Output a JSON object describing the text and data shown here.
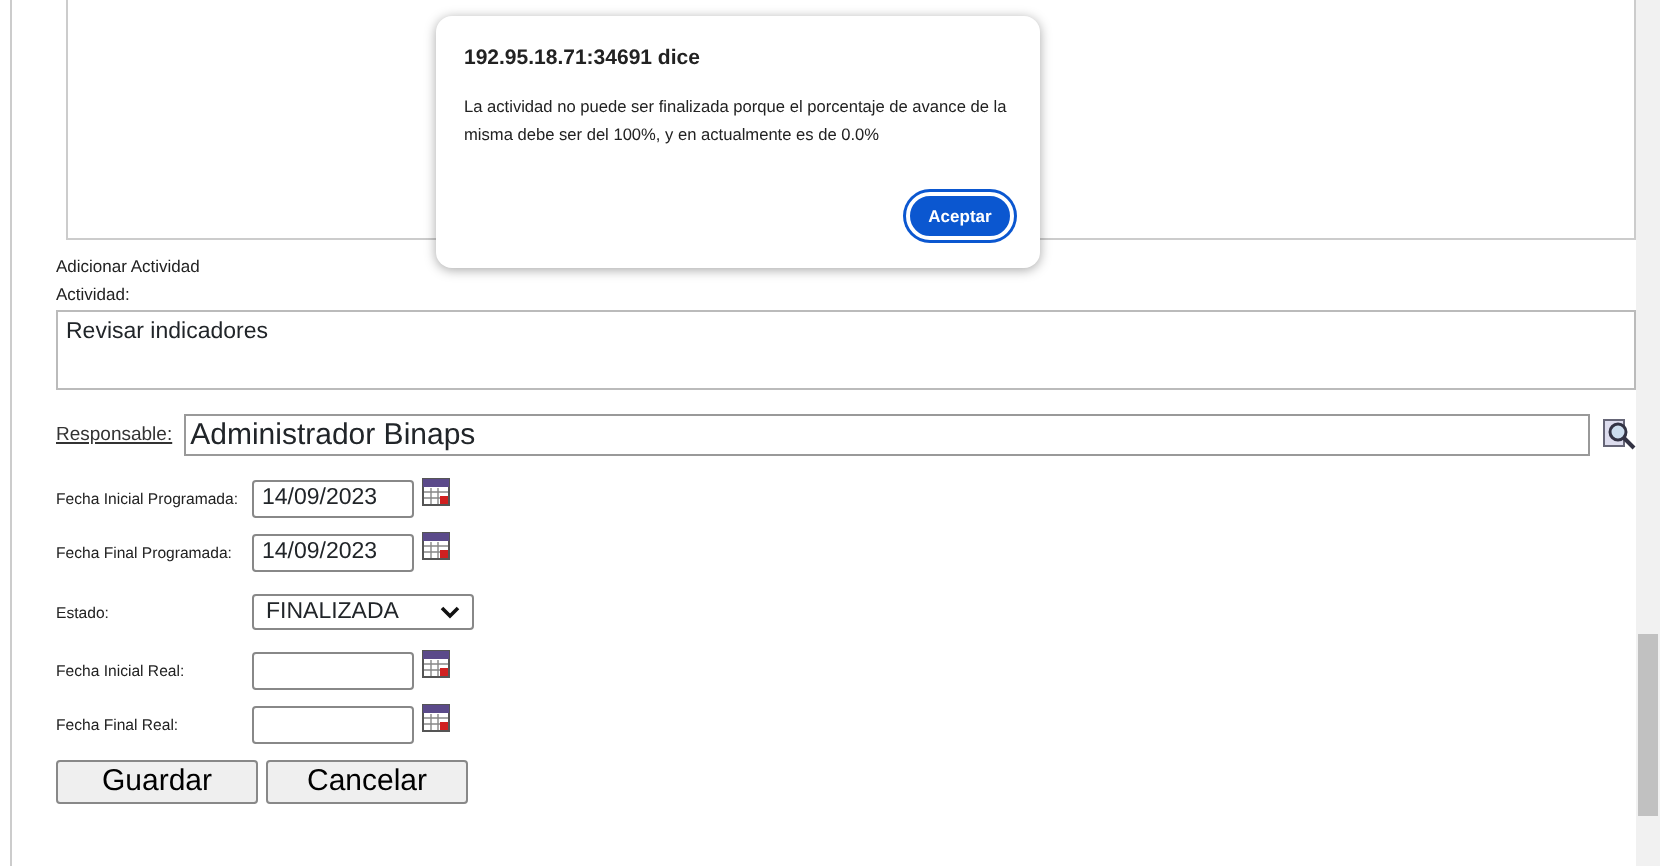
{
  "dialog": {
    "title": "192.95.18.71:34691 dice",
    "message": "La actividad no puede ser finalizada porque el porcentaje de avance de la misma debe ser del 100%, y en actualmente es de 0.0%",
    "button": "Aceptar"
  },
  "form": {
    "heading": "Adicionar Actividad",
    "activity_label": "Actividad:",
    "activity_value": "Revisar indicadores",
    "responsible_label": "Responsable:",
    "responsible_value": "Administrador Binaps",
    "fields": [
      {
        "kind": "date",
        "label": "Fecha Inicial Programada:",
        "value": "14/09/2023"
      },
      {
        "kind": "date",
        "label": "Fecha Final Programada:",
        "value": "14/09/2023"
      },
      {
        "kind": "select",
        "label": "Estado:",
        "value": "FINALIZADA"
      },
      {
        "kind": "date",
        "label": "Fecha Inicial Real:"
      },
      {
        "kind": "date",
        "label": "Fecha Final Real:"
      }
    ]
  },
  "buttons": [
    "Guardar",
    "Cancelar"
  ]
}
